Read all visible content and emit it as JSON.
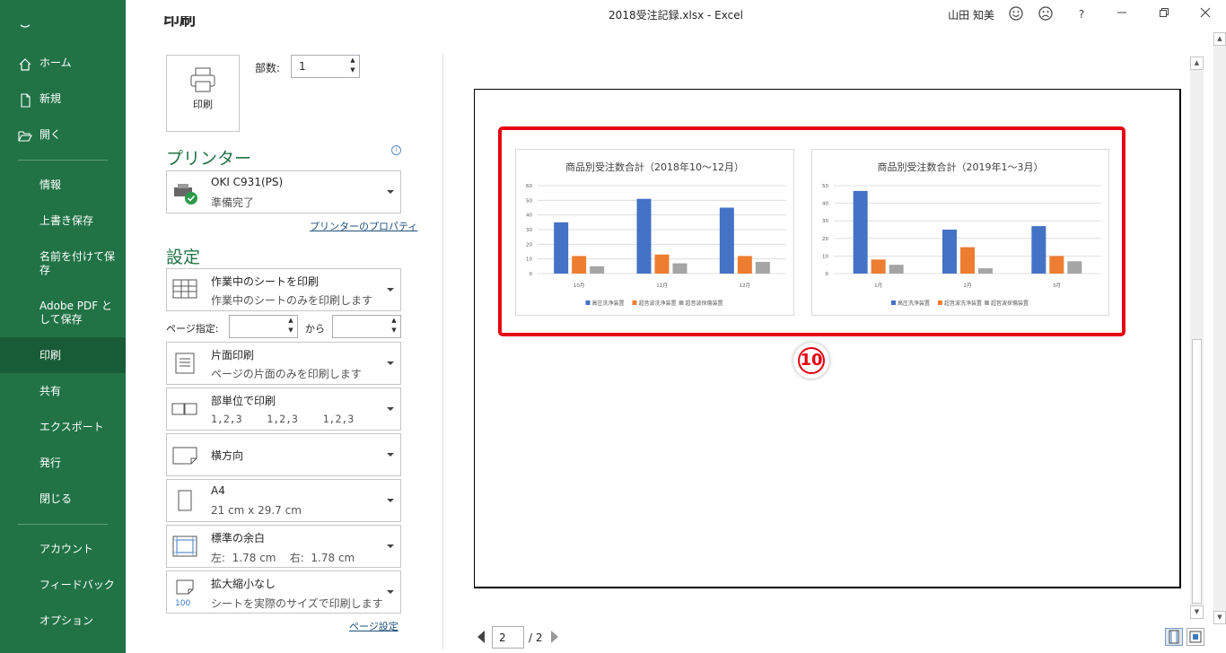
{
  "titlebar": {
    "title": "2018受注記録.xlsx  -  Excel",
    "user": "山田 知美",
    "help": "?",
    "smile_icon": "smile-icon",
    "frown_icon": "frown-icon"
  },
  "nav": {
    "home": "ホーム",
    "new": "新規",
    "open": "開く",
    "info": "情報",
    "save": "上書き保存",
    "save_as": "名前を付けて保存",
    "adobe_pdf": "Adobe PDF として保存",
    "print": "印刷",
    "share": "共有",
    "export": "エクスポート",
    "publish": "発行",
    "close": "閉じる",
    "account": "アカウント",
    "feedback": "フィードバック",
    "options": "オプション"
  },
  "print": {
    "heading": "印刷",
    "print_button": "印刷",
    "copies_label": "部数:",
    "copies_value": "1"
  },
  "printer": {
    "section": "プリンター",
    "name": "OKI C931(PS)",
    "status": "準備完了",
    "properties_link": "プリンターのプロパティ"
  },
  "settings": {
    "section": "設定",
    "what": {
      "main": "作業中のシートを印刷",
      "sub": "作業中のシートのみを印刷します"
    },
    "pages_label": "ページ指定:",
    "to_label": "から",
    "sides": {
      "main": "片面印刷",
      "sub": "ページの片面のみを印刷します"
    },
    "collate": {
      "main": "部単位で印刷",
      "sub": "1,2,3    1,2,3    1,2,3"
    },
    "orientation": {
      "main": "横方向"
    },
    "paper": {
      "main": "A4",
      "sub": "21 cm x 29.7 cm"
    },
    "margins": {
      "main": "標準の余白",
      "sub": "左:  1.78 cm    右:  1.78 cm"
    },
    "scaling": {
      "main": "拡大縮小なし",
      "sub": "シートを実際のサイズで印刷します",
      "icon_text": "100"
    },
    "page_setup_link": "ページ設定"
  },
  "preview": {
    "badge": "10",
    "current_page": "2",
    "total_pages": "/ 2",
    "highlight_color": "#e60012"
  },
  "chart_data": [
    {
      "type": "bar",
      "title": "商品別受注数合計（2018年10～12月）",
      "categories": [
        "10月",
        "11月",
        "12月"
      ],
      "series": [
        {
          "name": "高圧洗浄装置",
          "color": "#4472c4",
          "values": [
            35,
            51,
            45
          ]
        },
        {
          "name": "超音波洗浄装置",
          "color": "#ed7d31",
          "values": [
            12,
            13,
            12
          ]
        },
        {
          "name": "超音波探傷装置",
          "color": "#a5a5a5",
          "values": [
            5,
            7,
            8
          ]
        }
      ],
      "ylim": [
        0,
        60
      ],
      "yticks": [
        "0",
        "10",
        "20",
        "30",
        "40",
        "50",
        "60"
      ],
      "grid": true,
      "legend": "bottom"
    },
    {
      "type": "bar",
      "title": "商品別受注数合計（2019年1～3月）",
      "categories": [
        "1月",
        "2月",
        "3月"
      ],
      "series": [
        {
          "name": "高圧洗浄装置",
          "color": "#4472c4",
          "values": [
            47,
            25,
            27
          ]
        },
        {
          "name": "超音波洗浄装置",
          "color": "#ed7d31",
          "values": [
            8,
            15,
            10
          ]
        },
        {
          "name": "超音波探傷装置",
          "color": "#a5a5a5",
          "values": [
            5,
            3,
            7
          ]
        }
      ],
      "ylim": [
        0,
        50
      ],
      "yticks": [
        "0",
        "10",
        "20",
        "30",
        "40",
        "50"
      ],
      "grid": true,
      "legend": "bottom"
    }
  ]
}
